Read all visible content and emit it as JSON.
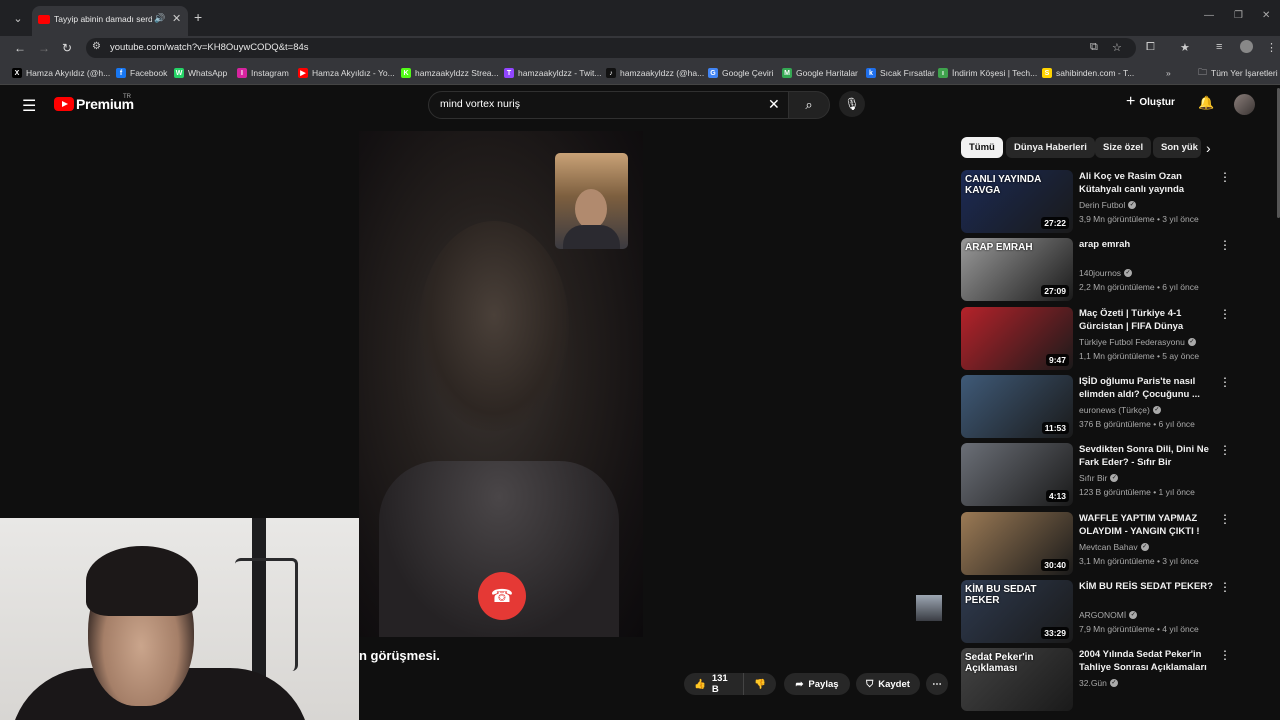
{
  "browser": {
    "tab_title": "Tayyip abinin damadı serdar",
    "url": "youtube.com/watch?v=KH8OuywCODQ&t=84s",
    "bookmarks": [
      {
        "label": "Hamza Akyıldız (@h...",
        "icon": "X",
        "color": "#000000"
      },
      {
        "label": "Facebook",
        "icon": "f",
        "color": "#1877f2"
      },
      {
        "label": "WhatsApp",
        "icon": "W",
        "color": "#25d366"
      },
      {
        "label": "Instagram",
        "icon": "I",
        "color": "#d6249f"
      },
      {
        "label": "Hamza Akyıldız - Yo...",
        "icon": "▶",
        "color": "#ff0000"
      },
      {
        "label": "hamzaakyldzz Strea...",
        "icon": "K",
        "color": "#53fc18"
      },
      {
        "label": "hamzaakyldzz - Twit...",
        "icon": "T",
        "color": "#9146ff"
      },
      {
        "label": "hamzaakyldzz (@ha...",
        "icon": "♪",
        "color": "#111111"
      },
      {
        "label": "Google Çeviri",
        "icon": "G",
        "color": "#4285f4"
      },
      {
        "label": "Google Haritalar",
        "icon": "M",
        "color": "#34a853"
      },
      {
        "label": "Sıcak Fırsatlar",
        "icon": "k",
        "color": "#1f6feb"
      },
      {
        "label": "İndirim Köşesi | Tech...",
        "icon": "ı",
        "color": "#3fa34d"
      },
      {
        "label": "sahibinden.com - T...",
        "icon": "S",
        "color": "#ffd400"
      }
    ],
    "all_bookmarks_label": "Tüm Yer İşaretleri"
  },
  "youtube": {
    "logo_text": "Premium",
    "region": "TR",
    "search_query": "mind vortex nuriş",
    "create_label": "Oluştur"
  },
  "video": {
    "title_visible": "n görüşmesi.",
    "likes": "131 B",
    "share_label": "Paylaş",
    "save_label": "Kaydet"
  },
  "chips": [
    "Tümü",
    "Dünya Haberleri",
    "Size özel",
    "Son yük"
  ],
  "recommendations": [
    {
      "title": "Ali Koç ve Rasim Ozan Kütahyalı canlı yayında birbirine girdi! ...",
      "channel": "Derin Futbol",
      "verified": true,
      "meta": "3,9 Mn görüntüleme • 3 yıl önce",
      "duration": "27:22",
      "thumb_text": "CANLI YAYINDA KAVGA",
      "thumb_color": "#1b2a55"
    },
    {
      "title": "arap emrah",
      "channel": "140journos",
      "verified": true,
      "meta": "2,2 Mn görüntüleme • 6 yıl önce",
      "duration": "27:09",
      "thumb_text": "ARAP EMRAH",
      "thumb_color": "#9a9a9a"
    },
    {
      "title": "Maç Özeti | Türkiye 4-1 Gürcistan | FIFA Dünya Kupası ...",
      "channel": "Türkiye Futbol Federasyonu",
      "verified": true,
      "meta": "1,1 Mn görüntüleme • 5 ay önce",
      "duration": "9:47",
      "thumb_text": "",
      "thumb_color": "#b5222a"
    },
    {
      "title": "IŞİD oğlumu Paris'te nasıl elimden aldı? Çocuğunu ...",
      "channel": "euronews (Türkçe)",
      "verified": true,
      "meta": "376 B görüntüleme • 6 yıl önce",
      "duration": "11:53",
      "thumb_text": "",
      "thumb_color": "#3f5a78"
    },
    {
      "title": "Sevdikten Sonra Dili, Dini Ne Fark Eder? - Sıfır Bir",
      "channel": "Sıfır Bir",
      "verified": true,
      "meta": "123 B görüntüleme • 1 yıl önce",
      "duration": "4:13",
      "thumb_text": "",
      "thumb_color": "#6b6f77"
    },
    {
      "title": "WAFFLE YAPTIM YAPMAZ OLAYDIM - YANGIN ÇIKTI !",
      "channel": "Mevtcan Bahav",
      "verified": true,
      "meta": "3,1 Mn görüntüleme • 3 yıl önce",
      "duration": "30:40",
      "thumb_text": "",
      "thumb_color": "#9b7a55"
    },
    {
      "title": "KİM BU REİS SEDAT PEKER?",
      "channel": "ARGONOMİ",
      "verified": true,
      "meta": "7,9 Mn görüntüleme • 4 yıl önce",
      "duration": "33:29",
      "thumb_text": "KİM BU SEDAT PEKER",
      "thumb_color": "#2e3a4f"
    },
    {
      "title": "2004 Yılında Sedat Peker'in Tahliye Sonrası Açıklamaları",
      "channel": "32.Gün",
      "verified": true,
      "meta": "",
      "duration": "",
      "thumb_text": "Sedat Peker'in Açıklaması",
      "thumb_color": "#444444"
    }
  ]
}
